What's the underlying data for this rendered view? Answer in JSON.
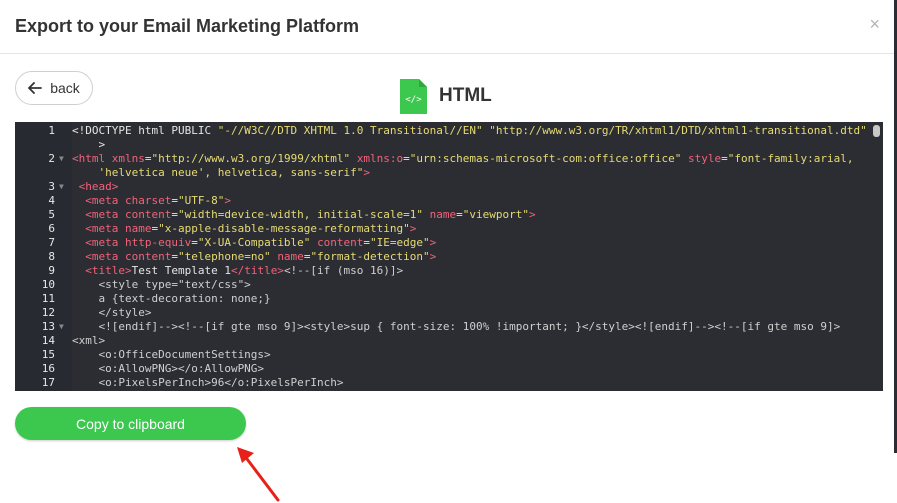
{
  "modal": {
    "title": "Export to your Email Marketing Platform",
    "close_glyph": "×"
  },
  "back_button": {
    "label": "back",
    "icon": "arrow-left-icon"
  },
  "file": {
    "label": "HTML",
    "icon": "html-file-icon",
    "icon_color": "#3cc84e"
  },
  "editor": {
    "lines": [
      {
        "n": "1",
        "fold": "",
        "html": "<span class='p'>&lt;!DOCTYPE html PUBLIC </span><span class='s'>\"-//W3C//DTD XHTML 1.0 Transitional//EN\"</span><span class='p'> </span><span class='s'>\"http://www.w3.org/TR/xhtml1/DTD/xhtml1-transitional.dtd\"</span>"
      },
      {
        "n": "",
        "fold": "",
        "html": "<span class='p'>    &gt;</span>"
      },
      {
        "n": "2",
        "fold": "▼",
        "html": "<span class='t'>&lt;html</span> <span class='a'>xmlns</span><span class='p'>=</span><span class='s'>\"http://www.w3.org/1999/xhtml\"</span> <span class='a'>xmlns:o</span><span class='p'>=</span><span class='s'>\"urn:schemas-microsoft-com:office:office\"</span> <span class='a'>style</span><span class='p'>=</span><span class='s'>\"font-family:arial,</span>"
      },
      {
        "n": "",
        "fold": "",
        "html": "<span class='s'>    'helvetica neue', helvetica, sans-serif\"</span><span class='t'>&gt;</span>"
      },
      {
        "n": "3",
        "fold": "▼",
        "html": "<span class='t'> &lt;head&gt;</span>"
      },
      {
        "n": "4",
        "fold": "",
        "html": "<span class='t'>  &lt;meta</span> <span class='a'>charset</span><span class='p'>=</span><span class='s'>\"UTF-8\"</span><span class='t'>&gt;</span>"
      },
      {
        "n": "5",
        "fold": "",
        "html": "<span class='t'>  &lt;meta</span> <span class='a'>content</span><span class='p'>=</span><span class='s'>\"width=device-width, initial-scale=1\"</span> <span class='a'>name</span><span class='p'>=</span><span class='s'>\"viewport\"</span><span class='t'>&gt;</span>"
      },
      {
        "n": "6",
        "fold": "",
        "html": "<span class='t'>  &lt;meta</span> <span class='a'>name</span><span class='p'>=</span><span class='s'>\"x-apple-disable-message-reformatting\"</span><span class='t'>&gt;</span>"
      },
      {
        "n": "7",
        "fold": "",
        "html": "<span class='t'>  &lt;meta</span> <span class='a'>http-equiv</span><span class='p'>=</span><span class='s'>\"X-UA-Compatible\"</span> <span class='a'>content</span><span class='p'>=</span><span class='s'>\"IE=edge\"</span><span class='t'>&gt;</span>"
      },
      {
        "n": "8",
        "fold": "",
        "html": "<span class='t'>  &lt;meta</span> <span class='a'>content</span><span class='p'>=</span><span class='s'>\"telephone=no\"</span> <span class='a'>name</span><span class='p'>=</span><span class='s'>\"format-detection\"</span><span class='t'>&gt;</span>"
      },
      {
        "n": "9",
        "fold": "",
        "html": "<span class='t'>  &lt;title&gt;</span><span class='p'>Test Template 1</span><span class='t'>&lt;/title&gt;</span><span class='c'>&lt;!--[if (mso 16)]&gt;</span>"
      },
      {
        "n": "10",
        "fold": "",
        "html": "<span class='c'>    &lt;style type=\"text/css\"&gt;</span>"
      },
      {
        "n": "11",
        "fold": "",
        "html": "<span class='c'>    a {text-decoration: none;}</span>"
      },
      {
        "n": "12",
        "fold": "",
        "html": "<span class='c'>    &lt;/style&gt;</span>"
      },
      {
        "n": "13",
        "fold": "▼",
        "html": "<span class='c'>    &lt;![endif]--&gt;&lt;!--[if gte mso 9]&gt;&lt;style&gt;sup { font-size: 100% !important; }&lt;/style&gt;&lt;![endif]--&gt;&lt;!--[if gte mso 9]&gt;</span>"
      },
      {
        "n": "14",
        "fold": "",
        "html": "<span class='c'>&lt;xml&gt;</span>"
      },
      {
        "n": "15",
        "fold": "",
        "html": "<span class='c'>    &lt;o:OfficeDocumentSettings&gt;</span>"
      },
      {
        "n": "16",
        "fold": "",
        "html": "<span class='c'>    &lt;o:AllowPNG&gt;&lt;/o:AllowPNG&gt;</span>"
      },
      {
        "n": "17",
        "fold": "",
        "html": "<span class='c'>    &lt;o:PixelsPerInch&gt;96&lt;/o:PixelsPerInch&gt;</span>"
      }
    ]
  },
  "copy_button": {
    "label": "Copy to clipboard",
    "color": "#3cc84e"
  },
  "annotation": {
    "arrow_color": "#e8201a",
    "icon": "red-arrow-icon"
  }
}
